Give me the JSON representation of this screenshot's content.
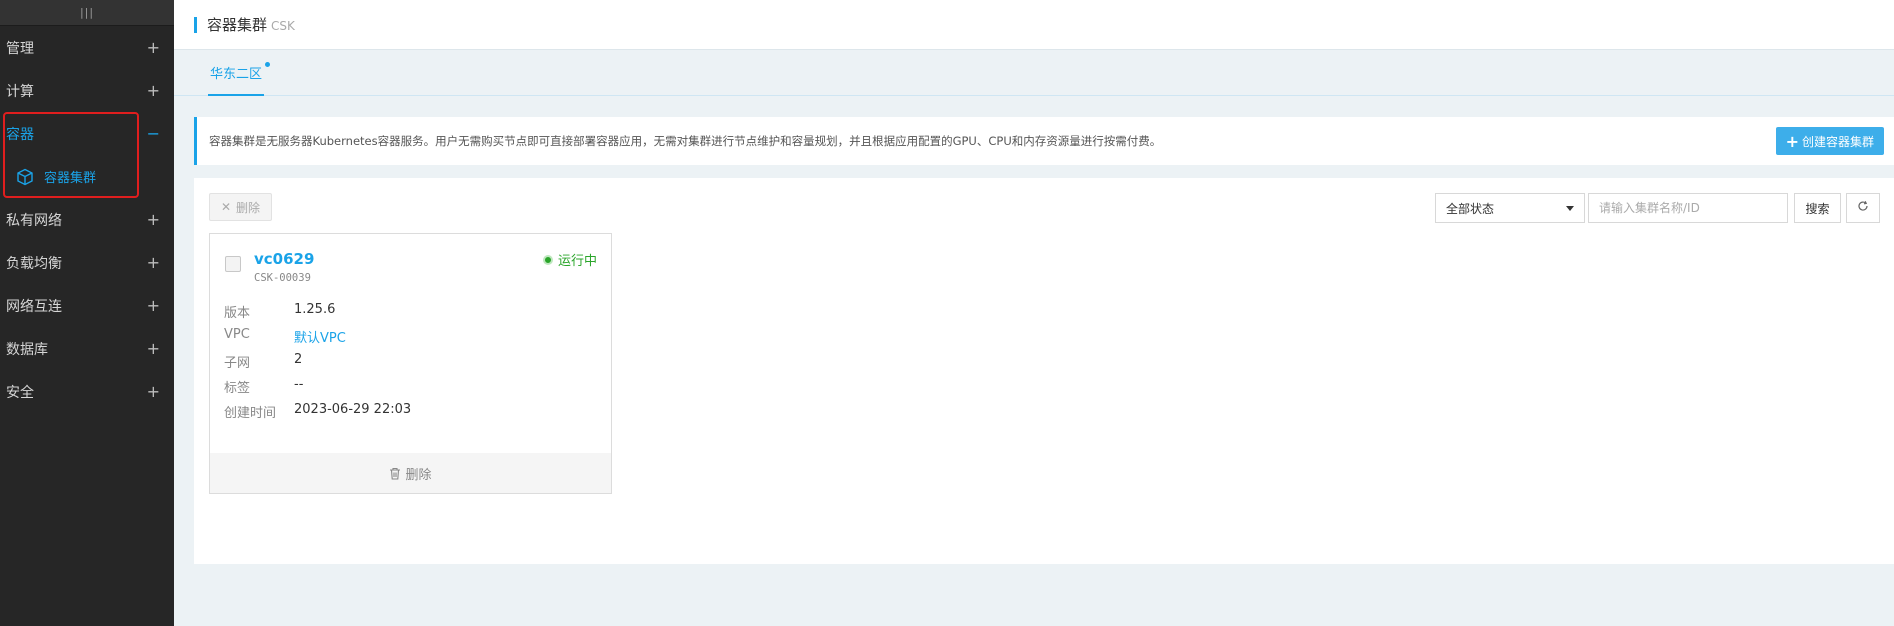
{
  "sidebar": {
    "top_glyph": "|||",
    "items": [
      {
        "label": "管理",
        "toggle": "+"
      },
      {
        "label": "计算",
        "toggle": "+"
      },
      {
        "label": "容器",
        "toggle": "−",
        "children": [
          {
            "label": "容器集群"
          }
        ]
      },
      {
        "label": "私有网络",
        "toggle": "+"
      },
      {
        "label": "负载均衡",
        "toggle": "+"
      },
      {
        "label": "网络互连",
        "toggle": "+"
      },
      {
        "label": "数据库",
        "toggle": "+"
      },
      {
        "label": "安全",
        "toggle": "+"
      }
    ]
  },
  "header": {
    "title": "容器集群",
    "subtitle": "CSK"
  },
  "tabs": [
    {
      "label": "华东二区"
    }
  ],
  "notice": {
    "text": "容器集群是无服务器Kubernetes容器服务。用户无需购买节点即可直接部署容器应用，无需对集群进行节点维护和容量规划，并且根据应用配置的GPU、CPU和内存资源量进行按需付费。",
    "create_label": "创建容器集群",
    "create_icon": "plus-icon"
  },
  "toolbar": {
    "delete_label": "删除",
    "filter_value": "全部状态",
    "search_placeholder": "请输入集群名称/ID",
    "search_label": "搜索",
    "refresh_icon": "refresh-icon"
  },
  "cluster_card": {
    "name": "vc0629",
    "id": "CSK-00039",
    "status": "运行中",
    "fields": [
      {
        "key": "版本",
        "value": "1.25.6"
      },
      {
        "key": "VPC",
        "value": "默认VPC"
      },
      {
        "key": "子网",
        "value": "2"
      },
      {
        "key": "标签",
        "value": "--"
      },
      {
        "key": "创建时间",
        "value": "2023-06-29 22:03"
      }
    ],
    "delete_label": "删除"
  },
  "colors": {
    "accent": "#1aa3e8",
    "sidebar_bg": "#262626",
    "status_green": "#2aa52a",
    "highlight_red": "#e01e1e"
  }
}
